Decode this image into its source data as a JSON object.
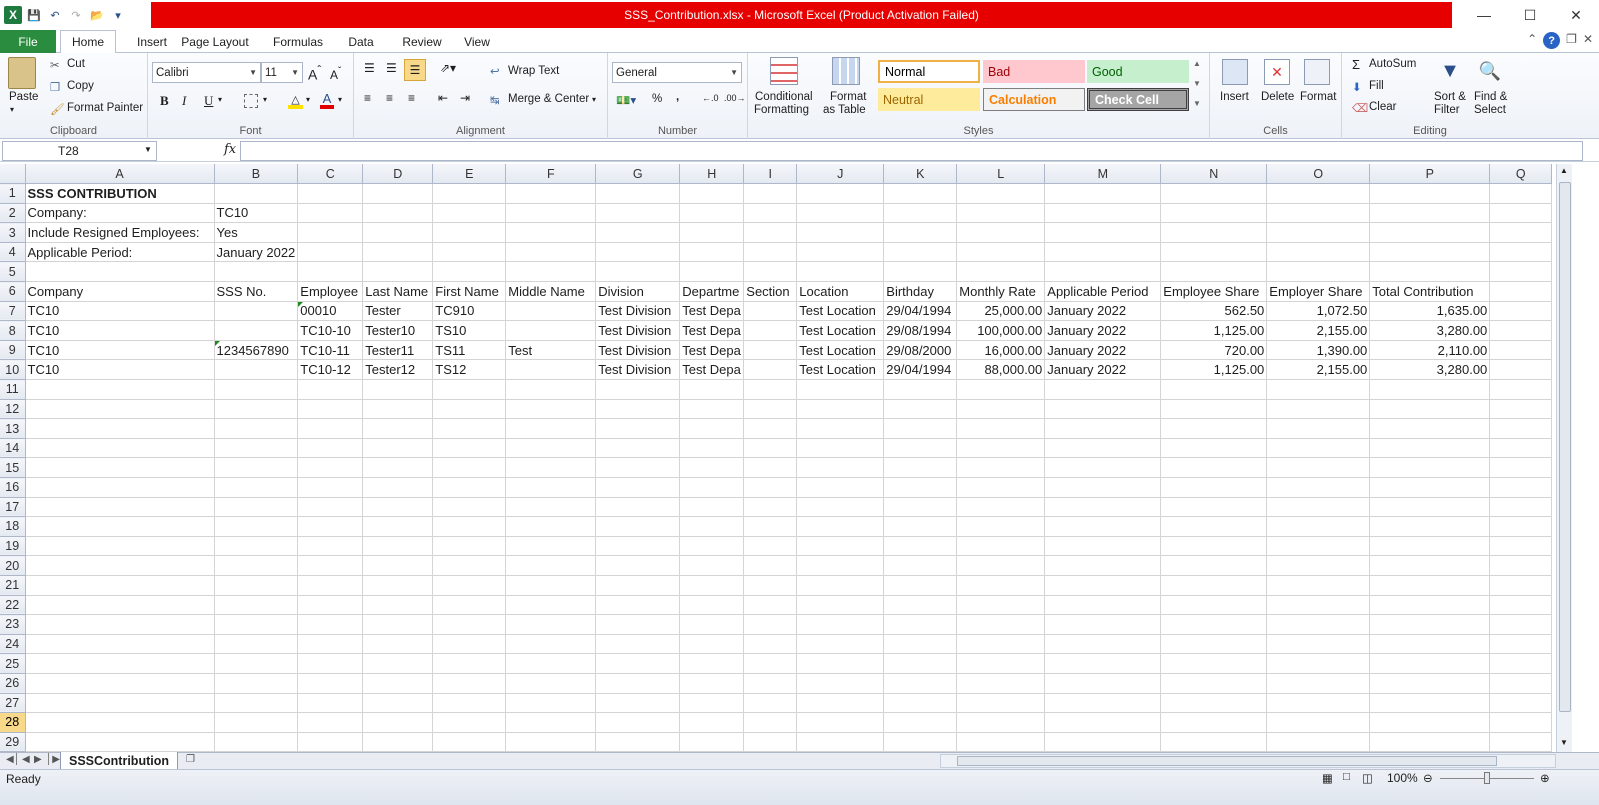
{
  "window": {
    "title": "SSS_Contribution.xlsx  -  Microsoft Excel (Product Activation Failed)"
  },
  "tabs": [
    "File",
    "Home",
    "Insert",
    "Page Layout",
    "Formulas",
    "Data",
    "Review",
    "View"
  ],
  "ribbon": {
    "clipboard": {
      "paste": "Paste",
      "cut": "Cut",
      "copy": "Copy",
      "format_painter": "Format Painter",
      "label": "Clipboard"
    },
    "font": {
      "name": "Calibri",
      "size": "11",
      "bold": "B",
      "italic": "I",
      "underline": "U",
      "label": "Font"
    },
    "alignment": {
      "wrap": "Wrap Text",
      "merge": "Merge & Center",
      "label": "Alignment"
    },
    "number": {
      "format": "General",
      "percent": "%",
      "comma": ",",
      "label": "Number"
    },
    "styles": {
      "conditional": "Conditional Formatting",
      "conditional_1": "Conditional",
      "conditional_2": "Formatting",
      "format_table_1": "Format",
      "format_table_2": "as Table",
      "normal": "Normal",
      "bad": "Bad",
      "good": "Good",
      "neutral": "Neutral",
      "calculation": "Calculation",
      "check_cell": "Check Cell",
      "label": "Styles"
    },
    "cells": {
      "insert": "Insert",
      "delete": "Delete",
      "format": "Format",
      "label": "Cells"
    },
    "editing": {
      "autosum": "AutoSum",
      "fill": "Fill",
      "clear": "Clear",
      "sort_1": "Sort &",
      "sort_2": "Filter",
      "find_1": "Find &",
      "find_2": "Select",
      "label": "Editing"
    }
  },
  "formula_bar": {
    "name_box": "T28",
    "fx": "fx",
    "formula": ""
  },
  "columns": [
    "A",
    "B",
    "C",
    "D",
    "E",
    "F",
    "G",
    "H",
    "I",
    "J",
    "K",
    "L",
    "M",
    "N",
    "O",
    "P",
    "Q"
  ],
  "rows": [
    [
      "SSS CONTRIBUTION",
      "",
      "",
      "",
      "",
      "",
      "",
      "",
      "",
      "",
      "",
      "",
      "",
      "",
      "",
      "",
      ""
    ],
    [
      "Company:",
      "TC10",
      "",
      "",
      "",
      "",
      "",
      "",
      "",
      "",
      "",
      "",
      "",
      "",
      "",
      "",
      ""
    ],
    [
      "Include Resigned Employees:",
      "Yes",
      "",
      "",
      "",
      "",
      "",
      "",
      "",
      "",
      "",
      "",
      "",
      "",
      "",
      "",
      ""
    ],
    [
      "Applicable Period:",
      "January 2022",
      "",
      "",
      "",
      "",
      "",
      "",
      "",
      "",
      "",
      "",
      "",
      "",
      "",
      "",
      ""
    ],
    [
      "",
      "",
      "",
      "",
      "",
      "",
      "",
      "",
      "",
      "",
      "",
      "",
      "",
      "",
      "",
      "",
      ""
    ],
    [
      "Company",
      "SSS No.",
      "Employee",
      "Last Name",
      "First Name",
      "Middle Name",
      "Division",
      "Departme",
      "Section",
      "Location",
      "Birthday",
      "Monthly Rate",
      "Applicable Period",
      "Employee Share",
      "Employer Share",
      "Total Contribution",
      ""
    ],
    [
      "TC10",
      "",
      "00010",
      "Tester",
      "TC910",
      "",
      "Test Division",
      "Test Depa",
      "",
      "Test Location",
      "29/04/1994",
      "25,000.00",
      "January 2022",
      "562.50",
      "1,072.50",
      "1,635.00",
      ""
    ],
    [
      "TC10",
      "",
      "TC10-10",
      "Tester10",
      "TS10",
      "",
      "Test Division",
      "Test Depa",
      "",
      "Test Location",
      "29/08/1994",
      "100,000.00",
      "January 2022",
      "1,125.00",
      "2,155.00",
      "3,280.00",
      ""
    ],
    [
      "TC10",
      "1234567890",
      "TC10-11",
      "Tester11",
      "TS11",
      "Test",
      "Test Division",
      "Test Depa",
      "",
      "Test Location",
      "29/08/2000",
      "16,000.00",
      "January 2022",
      "720.00",
      "1,390.00",
      "2,110.00",
      ""
    ],
    [
      "TC10",
      "",
      "TC10-12",
      "Tester12",
      "TS12",
      "",
      "Test Division",
      "Test Depa",
      "",
      "Test Location",
      "29/04/1994",
      "88,000.00",
      "January 2022",
      "1,125.00",
      "2,155.00",
      "3,280.00",
      ""
    ]
  ],
  "total_rows": 29,
  "selected_row": 28,
  "sheet_tab": "SSSContribution",
  "status": {
    "ready": "Ready",
    "zoom": "100%"
  }
}
